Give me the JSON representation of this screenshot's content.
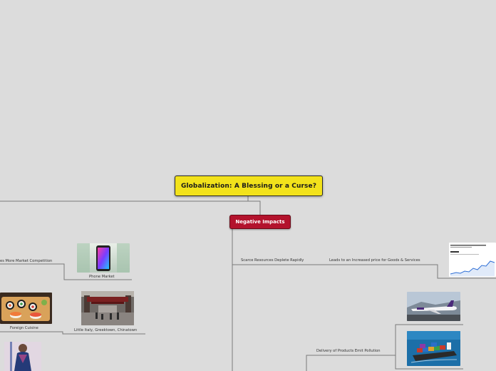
{
  "map": {
    "root_title": "Globalization: A Blessing or a Curse?",
    "main_topic": "Negative Impacts",
    "topics": {
      "competition": "es More Market Competition",
      "phone_market": "Phone Market",
      "foreign_cuisine": "Foreign Cuisine",
      "ethnic_towns": "Little Italy, Greektown, Chinatown",
      "scarce_resources": "Scarce Resources Deplete Rapidly",
      "increased_price": "Leads to an Increased price for Goods & Services",
      "pollution": "Delivery of Products Emit Pollution"
    },
    "images": {
      "phone": "phone-image",
      "sushi": "sushi-image",
      "street": "street-image",
      "person": "person-image",
      "price_chart": "price-chart-image",
      "airplane": "airplane-image",
      "ship": "cargo-ship-image"
    }
  },
  "colors": {
    "background": "#dcdcdc",
    "root_fill": "#f2e21b",
    "main_topic_fill": "#b3132d",
    "line": "#7a7a7a"
  }
}
